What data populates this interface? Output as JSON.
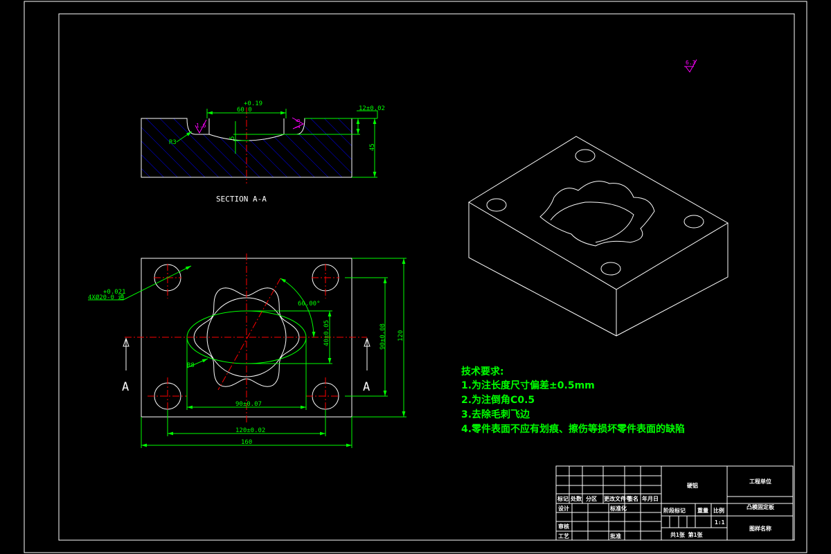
{
  "colors": {
    "outline": "#ffffff",
    "dimension": "#00ff00",
    "centerline": "#ff0000",
    "hatch": "#0000ff",
    "roughness": "#ff00ff"
  },
  "section_view": {
    "title": "SECTION A-A",
    "dim_width_tol": "+0.19",
    "dim_width": "60 0",
    "dim_depth": "12±0.02",
    "dim_height": "45",
    "dim_inner": "5",
    "radius": "R3",
    "roughness_left": "1.6",
    "roughness_right": "1.6"
  },
  "plan_view": {
    "hole_tol": "+0.021",
    "hole_note": "4XØ20-0 通",
    "angle": "60.00°",
    "dim_ellipse_h": "40±0.05",
    "dim_holes_v": "90±0.08",
    "dim_height": "120",
    "radius": "R8",
    "dim_ellipse_w": "90±0.07",
    "dim_holes_h": "120±0.02",
    "dim_width": "160",
    "section_mark_left": "A",
    "section_mark_right": "A"
  },
  "roughness_general": "6.3",
  "requirements": {
    "title": "技术要求:",
    "items": [
      "1.为注长度尺寸偏差±0.5mm",
      "2.为注倒角C0.5",
      "3.去除毛刺飞边",
      "4.零件表面不应有划痕、擦伤等损坏零件表面的缺陷"
    ]
  },
  "title_block": {
    "headers": [
      "标记",
      "处数",
      "分区",
      "更改文件号",
      "签名",
      "年月日"
    ],
    "design": "设计",
    "standard": "标准化",
    "review": "审核",
    "process": "工艺",
    "approve": "批准",
    "material": "硬铝",
    "stage_mark": "阶段标记",
    "weight": "重量",
    "scale_label": "比例",
    "scale": "1:1",
    "sheets": "共1张  第1张",
    "unit": "工程单位",
    "drawing_name": "凸模固定板",
    "drawing_no": "图样名称"
  }
}
